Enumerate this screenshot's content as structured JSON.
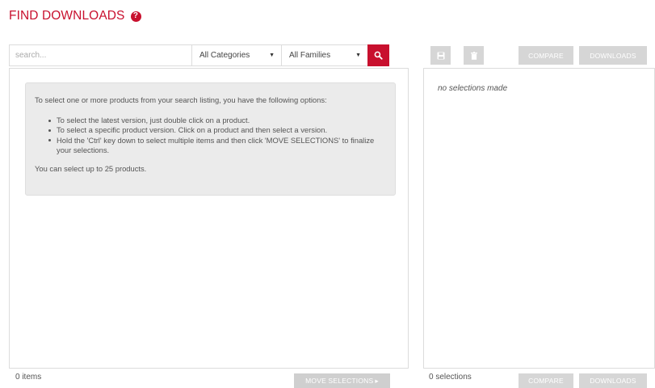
{
  "header": {
    "title": "FIND DOWNLOADS",
    "help_glyph": "?"
  },
  "colors": {
    "brand_red": "#c8102e",
    "disabled_gray": "#d6d6d6"
  },
  "search": {
    "placeholder": "search...",
    "value": "",
    "categories_selected": "All Categories",
    "families_selected": "All Families",
    "button_icon": "search-icon"
  },
  "instructions": {
    "intro": "To select one or more products from your search listing, you have the following options:",
    "options": [
      "To select the latest version, just double click on a product.",
      "To select a specific product version. Click on a product and then select a version.",
      "Hold the 'Ctrl' key down to select multiple items and then click 'MOVE SELECTIONS' to finalize your selections."
    ],
    "limit": "You can select up to 25 products."
  },
  "left_footer": {
    "items_count": "0 items",
    "move_label": "MOVE SELECTIONS",
    "move_glyph": "▸"
  },
  "right_toolbar": {
    "save_icon": "save-icon",
    "delete_icon": "trash-icon",
    "compare_label": "COMPARE",
    "downloads_label": "DOWNLOADS"
  },
  "selections": {
    "empty_text": "no selections made",
    "count": "0 selections"
  },
  "right_footer": {
    "compare_label": "COMPARE",
    "downloads_label": "DOWNLOADS"
  }
}
